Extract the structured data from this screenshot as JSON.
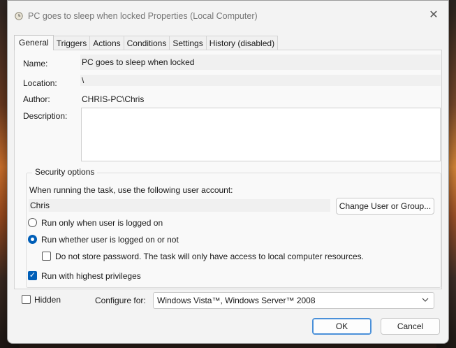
{
  "window": {
    "title": "PC goes to sleep when locked Properties (Local Computer)"
  },
  "tabs": [
    {
      "label": "General",
      "active": true
    },
    {
      "label": "Triggers"
    },
    {
      "label": "Actions"
    },
    {
      "label": "Conditions"
    },
    {
      "label": "Settings"
    },
    {
      "label": "History (disabled)"
    }
  ],
  "general": {
    "name_label": "Name:",
    "name_value": "PC goes to sleep when locked",
    "location_label": "Location:",
    "location_value": "\\",
    "author_label": "Author:",
    "author_value": "CHRIS-PC\\Chris",
    "description_label": "Description:",
    "description_value": ""
  },
  "security": {
    "legend": "Security options",
    "account_prompt": "When running the task, use the following user account:",
    "account_value": "Chris",
    "change_user_button": "Change User or Group...",
    "radio_logged_on": "Run only when user is logged on",
    "radio_logged_on_checked": false,
    "radio_whether": "Run whether user is logged on or not",
    "radio_whether_checked": true,
    "no_store_password": "Do not store password.  The task will only have access to local computer resources.",
    "no_store_password_checked": false,
    "highest_privileges": "Run with highest privileges",
    "highest_privileges_checked": true
  },
  "footer": {
    "hidden_label": "Hidden",
    "hidden_checked": false,
    "configure_label": "Configure for:",
    "configure_value": "Windows Vista™, Windows Server™ 2008",
    "ok": "OK",
    "cancel": "Cancel"
  },
  "colors": {
    "accent": "#005fb8",
    "dialog_bg": "#f3f3f3"
  },
  "icons": {
    "title": "clock-icon",
    "close": "close-icon",
    "dropdown": "chevron-down-icon",
    "check": "checkmark-icon"
  }
}
